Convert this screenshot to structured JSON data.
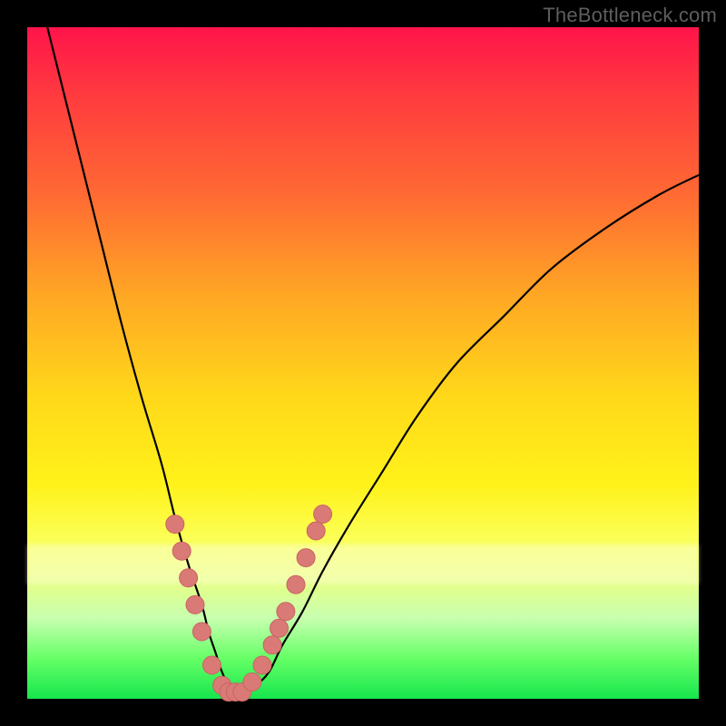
{
  "watermark": "TheBottleneck.com",
  "colors": {
    "background": "#000000",
    "curve": "#000000",
    "dot_fill": "#d97a77",
    "dot_stroke": "#c86560",
    "gradient_top": "#ff144a",
    "gradient_bottom": "#16e64e"
  },
  "chart_data": {
    "type": "line",
    "title": "",
    "xlabel": "",
    "ylabel": "",
    "xlim": [
      0,
      100
    ],
    "ylim": [
      0,
      100
    ],
    "grid": false,
    "series": [
      {
        "name": "bottleneck-curve",
        "x": [
          3,
          5,
          8,
          11,
          14,
          17,
          20,
          22,
          24,
          26,
          27,
          28,
          29,
          30,
          31,
          32,
          34,
          36,
          38,
          41,
          44,
          48,
          53,
          58,
          64,
          71,
          78,
          86,
          94,
          100
        ],
        "y": [
          100,
          92,
          80,
          68,
          56,
          45,
          35,
          27,
          20,
          14,
          10,
          7,
          4,
          2,
          1,
          1,
          2,
          4,
          8,
          13,
          19,
          26,
          34,
          42,
          50,
          57,
          64,
          70,
          75,
          78
        ]
      }
    ],
    "markers": [
      {
        "x": 22.0,
        "y": 26.0
      },
      {
        "x": 23.0,
        "y": 22.0
      },
      {
        "x": 24.0,
        "y": 18.0
      },
      {
        "x": 25.0,
        "y": 14.0
      },
      {
        "x": 26.0,
        "y": 10.0
      },
      {
        "x": 27.5,
        "y": 5.0
      },
      {
        "x": 29.0,
        "y": 2.0
      },
      {
        "x": 30.0,
        "y": 1.0
      },
      {
        "x": 31.0,
        "y": 1.0
      },
      {
        "x": 32.0,
        "y": 1.0
      },
      {
        "x": 33.5,
        "y": 2.5
      },
      {
        "x": 35.0,
        "y": 5.0
      },
      {
        "x": 36.5,
        "y": 8.0
      },
      {
        "x": 37.5,
        "y": 10.5
      },
      {
        "x": 38.5,
        "y": 13.0
      },
      {
        "x": 40.0,
        "y": 17.0
      },
      {
        "x": 41.5,
        "y": 21.0
      },
      {
        "x": 43.0,
        "y": 25.0
      },
      {
        "x": 44.0,
        "y": 27.5
      }
    ],
    "marker_radius_px": 10
  }
}
